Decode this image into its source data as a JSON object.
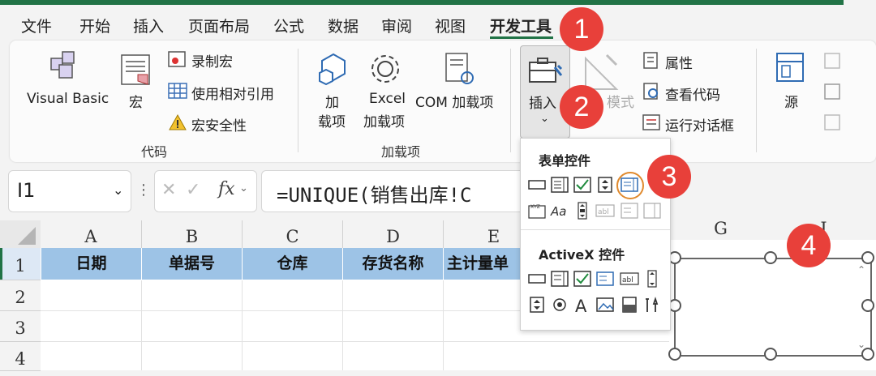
{
  "tabs": [
    "文件",
    "开始",
    "插入",
    "页面布局",
    "公式",
    "数据",
    "审阅",
    "视图",
    "开发工具"
  ],
  "ribbon": {
    "visual_basic": "Visual Basic",
    "macros": "宏",
    "record_macro": "录制宏",
    "relative_ref": "使用相对引用",
    "macro_security": "宏安全性",
    "group_code": "代码",
    "addins_line1": "加",
    "addins_line2": "载项",
    "excel_addins_line1": "Excel",
    "excel_addins_line2": "加载项",
    "com_addins": "COM 加载项",
    "group_addins": "加载项",
    "insert": "插入",
    "design_mode_partial": "模式",
    "properties": "属性",
    "view_code": "查看代码",
    "run_dialog": "运行对话框",
    "source": "源"
  },
  "formula_bar": {
    "name_box": "I1",
    "fx": "fx",
    "formula": "=UNIQUE(销售出库!C"
  },
  "grid": {
    "columns": [
      "A",
      "B",
      "C",
      "D",
      "E"
    ],
    "columns_right": [
      "G",
      "I"
    ],
    "rows": [
      "1",
      "2",
      "3",
      "4"
    ],
    "headers": [
      "日期",
      "单据号",
      "仓库",
      "存货名称",
      "主计量单"
    ]
  },
  "dropdown": {
    "form_controls_title": "表单控件",
    "activex_title": "ActiveX 控件"
  },
  "badges": [
    "1",
    "2",
    "3",
    "4"
  ]
}
